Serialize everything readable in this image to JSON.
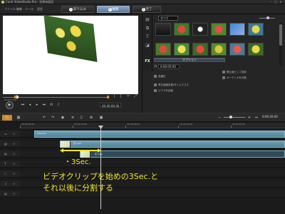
{
  "window": {
    "title": "Corel VideoStudio Pro - 名称未設定"
  },
  "menu": {
    "items": [
      "ファイル",
      "編集",
      "ツール",
      "設定"
    ]
  },
  "steps": [
    {
      "num": "1",
      "label": "取り込み",
      "active": false
    },
    {
      "num": "2",
      "label": "編集",
      "active": true
    },
    {
      "num": "3",
      "label": "完了",
      "active": false
    }
  ],
  "preview": {
    "mode_label": "Project Clip",
    "timecode": "00:00:00:00"
  },
  "library": {
    "dropdown": "すべて",
    "options_label": "オプション",
    "thumb_labels": [
      "",
      "",
      "",
      "",
      "",
      "",
      "",
      "",
      "",
      "",
      "",
      ""
    ]
  },
  "properties": {
    "timecode": "0:00:05:00",
    "items": [
      "色補正",
      "再生速度変更/タイムラプス",
      "ビデオを反転",
      "静止画として保存",
      "オーディオを分割"
    ]
  },
  "timeline": {
    "time": "0:00:20:00",
    "ruler_labels": [
      "00:00:00:00",
      "00:00:04:00",
      "00:00:08:00",
      "00:00:12:00",
      "00:00:16:00"
    ],
    "overlay_clip_name": "Clip.mov",
    "video_clip_name": "花.mp4",
    "split_clip_name": "花.mp4"
  },
  "annotation": {
    "seconds_label": "3Sec.",
    "line1": "ビデオクリップを始めの3Sec.と",
    "line2": "それ以後に分割する"
  }
}
